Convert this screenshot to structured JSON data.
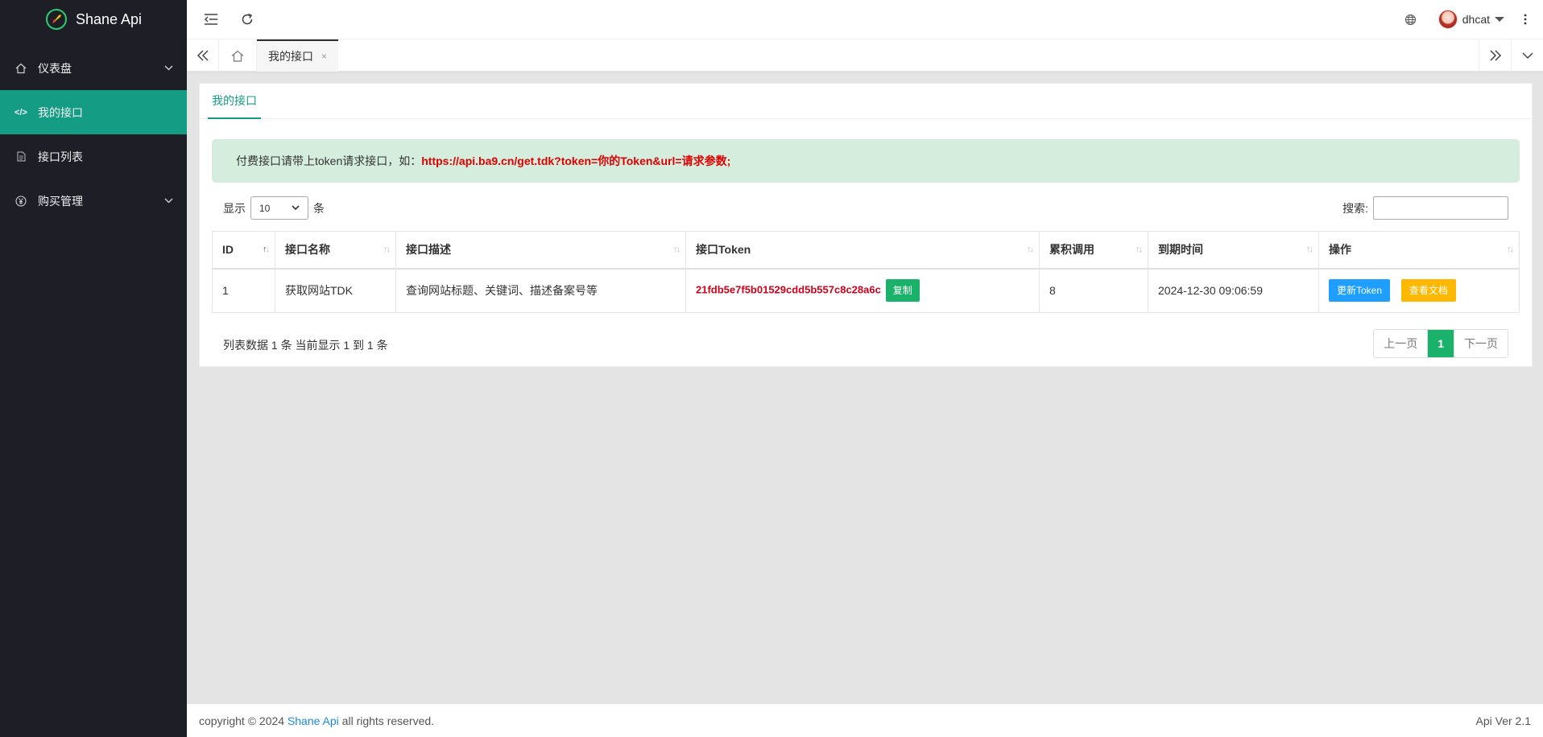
{
  "app": {
    "name": "Shane Api"
  },
  "sidebar": {
    "items": [
      {
        "label": "仪表盘",
        "icon": "home-icon",
        "has_children": true,
        "active": false
      },
      {
        "label": "我的接口",
        "icon": "code-icon",
        "has_children": false,
        "active": true
      },
      {
        "label": "接口列表",
        "icon": "document-icon",
        "has_children": false,
        "active": false
      },
      {
        "label": "购买管理",
        "icon": "yen-icon",
        "has_children": true,
        "active": false
      }
    ]
  },
  "header": {
    "user_name": "dhcat"
  },
  "tabs": {
    "active_label": "我的接口",
    "close_glyph": "×"
  },
  "page": {
    "card_tab": "我的接口",
    "notice_text": "付费接口请带上token请求接口，如：",
    "notice_url": "https://api.ba9.cn/get.tdk?token=你的Token&url=请求参数;",
    "length_prefix": "显示",
    "length_value": "10",
    "length_suffix": "条",
    "search_label": "搜索:",
    "search_value": ""
  },
  "table": {
    "columns": [
      "ID",
      "接口名称",
      "接口描述",
      "接口Token",
      "累积调用",
      "到期时间",
      "操作"
    ],
    "rows": [
      {
        "id": "1",
        "name": "获取网站TDK",
        "desc": "查询网站标题、关键词、描述备案号等",
        "token": "21fdb5e7f5b01529cdd5b557c8c28a6c",
        "copy_label": "复制",
        "calls": "8",
        "expire": "2024-12-30 09:06:59",
        "btn_refresh": "更新Token",
        "btn_docs": "查看文档"
      }
    ]
  },
  "pagination": {
    "info": "列表数据 1 条 当前显示 1 到 1 条",
    "prev": "上一页",
    "current": "1",
    "next": "下一页"
  },
  "footer": {
    "copyright_prefix": "copyright © 2024",
    "brand": "Shane Api",
    "copyright_suffix": "all rights reserved.",
    "version": "Api Ver 2.1"
  },
  "colors": {
    "sidebar_bg": "#1d1e26",
    "accent": "#149c84",
    "notice_bg": "#d4eddc",
    "token_red": "#d0021b",
    "btn_green": "#1ab26b",
    "btn_blue": "#1e9fff",
    "btn_orange": "#ffb800"
  }
}
